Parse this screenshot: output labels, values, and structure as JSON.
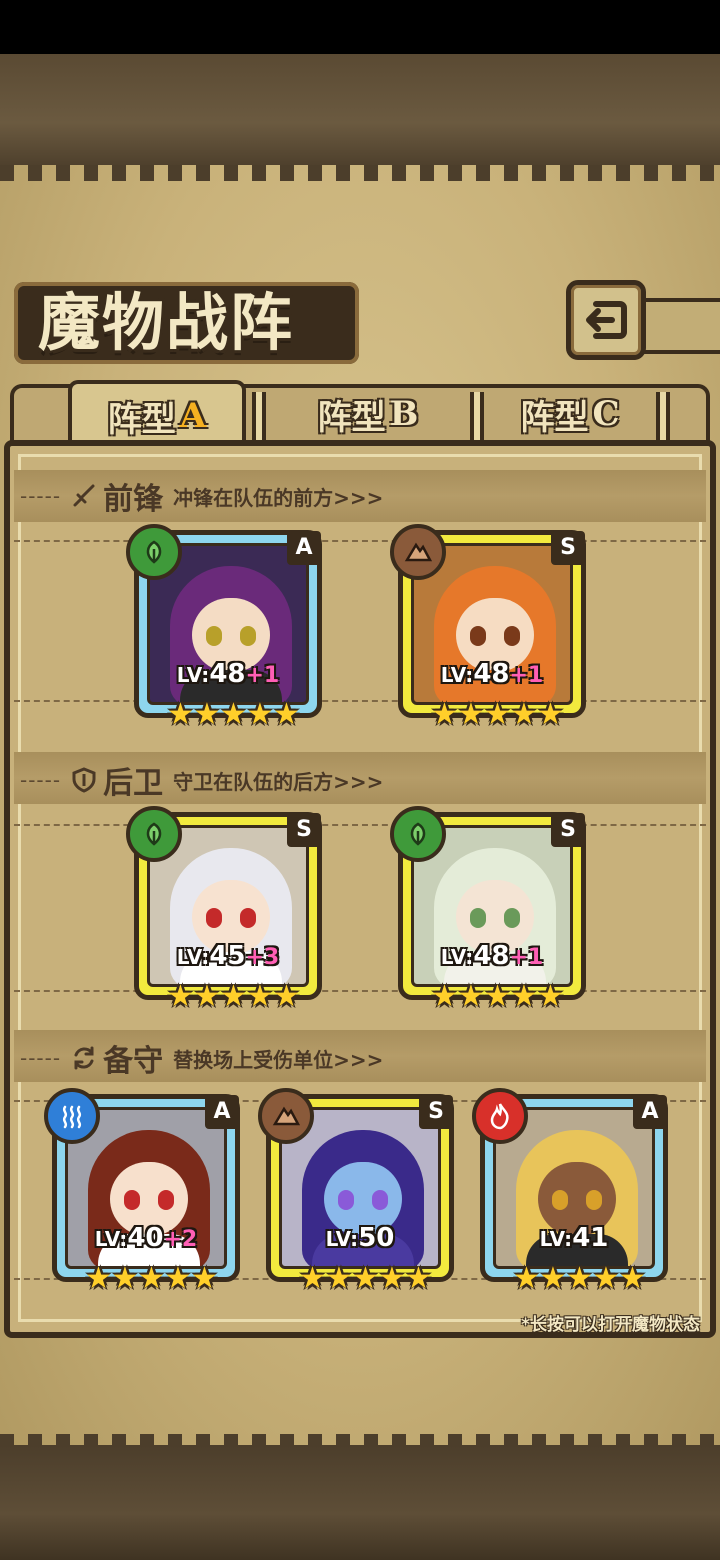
{
  "title": "魔物战阵",
  "tabs": [
    {
      "label": "阵型",
      "suffix": "A",
      "active": true
    },
    {
      "label": "阵型",
      "suffix": "B",
      "active": false
    },
    {
      "label": "阵型",
      "suffix": "C",
      "active": false
    }
  ],
  "sections": {
    "front": {
      "dashes": "-----",
      "title": "前锋",
      "desc": "冲锋在队伍的前方>>>",
      "icon": "sword-icon"
    },
    "rear": {
      "dashes": "-----",
      "title": "后卫",
      "desc": "守卫在队伍的后方>>>",
      "icon": "shield-icon"
    },
    "reserve": {
      "dashes": "-----",
      "title": "备守",
      "desc": "替换场上受伤单位>>>",
      "icon": "swap-icon"
    }
  },
  "cards": {
    "front1": {
      "rank": "A",
      "element": "leaf-icon",
      "lvtag": "LV:",
      "level": "48",
      "bonus": "+1",
      "stars": 5
    },
    "front2": {
      "rank": "S",
      "element": "mountain-icon",
      "lvtag": "LV:",
      "level": "48",
      "bonus": "+1",
      "stars": 5
    },
    "rear1": {
      "rank": "S",
      "element": "leaf-icon",
      "lvtag": "LV:",
      "level": "45",
      "bonus": "+3",
      "stars": 5
    },
    "rear2": {
      "rank": "S",
      "element": "leaf-icon",
      "lvtag": "LV:",
      "level": "48",
      "bonus": "+1",
      "stars": 5
    },
    "res1": {
      "rank": "A",
      "element": "water-icon",
      "lvtag": "LV:",
      "level": "40",
      "bonus": "+2",
      "stars": 5
    },
    "res2": {
      "rank": "S",
      "element": "mountain-icon",
      "lvtag": "LV:",
      "level": "50",
      "bonus": "",
      "stars": 5
    },
    "res3": {
      "rank": "A",
      "element": "fire-icon",
      "lvtag": "LV:",
      "level": "41",
      "bonus": "",
      "stars": 5
    }
  },
  "star_glyph": "★",
  "hint": "*长按可以打开魔物状态",
  "colors": {
    "leaf": "#3f9a3a",
    "mountain": "#8a5a3a",
    "water": "#2f7fd8",
    "fire": "#d8302a",
    "card_gold": "#f2ea3e",
    "card_blue": "#8ed6ee",
    "bonus": "#ff5fb5"
  }
}
